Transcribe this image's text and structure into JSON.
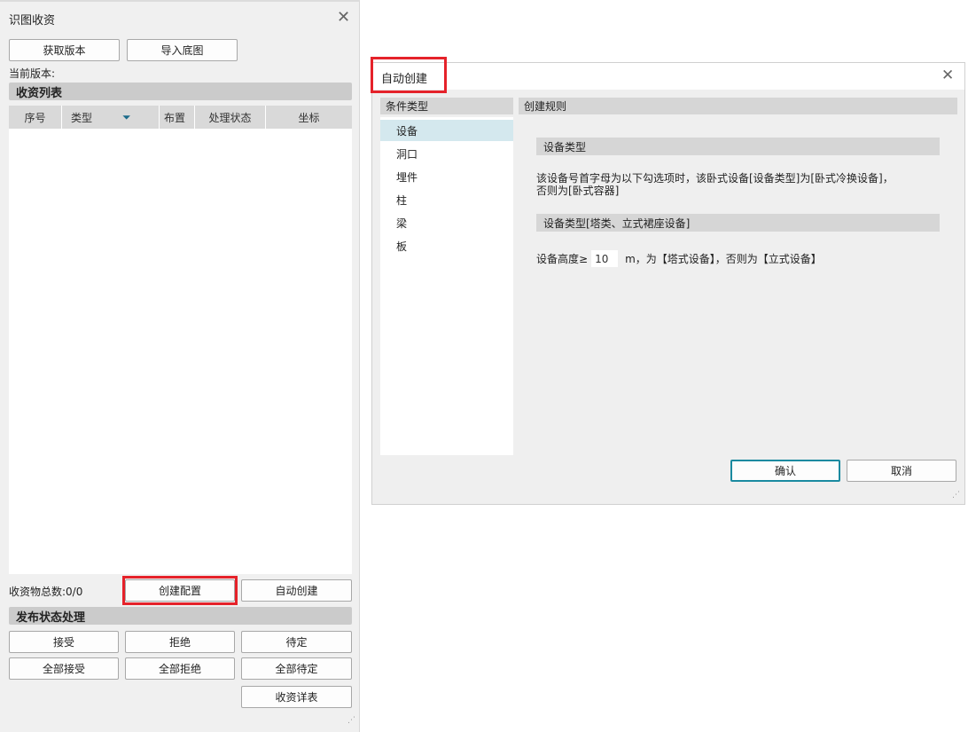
{
  "left_panel": {
    "title": "识图收资",
    "get_version": "获取版本",
    "import_base": "导入底图",
    "current_version_label": "当前版本:",
    "list_section": "收资列表",
    "columns": [
      "序号",
      "类型",
      "布置",
      "处理状态",
      "坐标"
    ],
    "total_label": "收资物总数:0/0",
    "create_config": "创建配置",
    "auto_create": "自动创建",
    "publish_section": "发布状态处理",
    "accept": "接受",
    "reject": "拒绝",
    "pending": "待定",
    "accept_all": "全部接受",
    "reject_all": "全部拒绝",
    "pending_all": "全部待定",
    "detail": "收资详表"
  },
  "dialog": {
    "title": "自动创建",
    "condition_header": "条件类型",
    "rule_header": "创建规则",
    "conditions": [
      "设备",
      "洞口",
      "埋件",
      "柱",
      "梁",
      "板"
    ],
    "selected": "设备",
    "group1_title": "设备类型",
    "group1_text1": "该设备号首字母为以下勾选项时，该卧式设备[设备类型]为[卧式冷换设备]，",
    "group1_text2": "否则为[卧式容器]",
    "group2_title": "设备类型[塔类、立式裙座设备]",
    "height_label": "设备高度≥",
    "height_value": "10",
    "height_suffix": "m，为【塔式设备】，否则为【立式设备】",
    "ok": "确认",
    "cancel": "取消"
  },
  "colors": {
    "highlight": "#e5222a",
    "accent": "#1a8aa0"
  }
}
